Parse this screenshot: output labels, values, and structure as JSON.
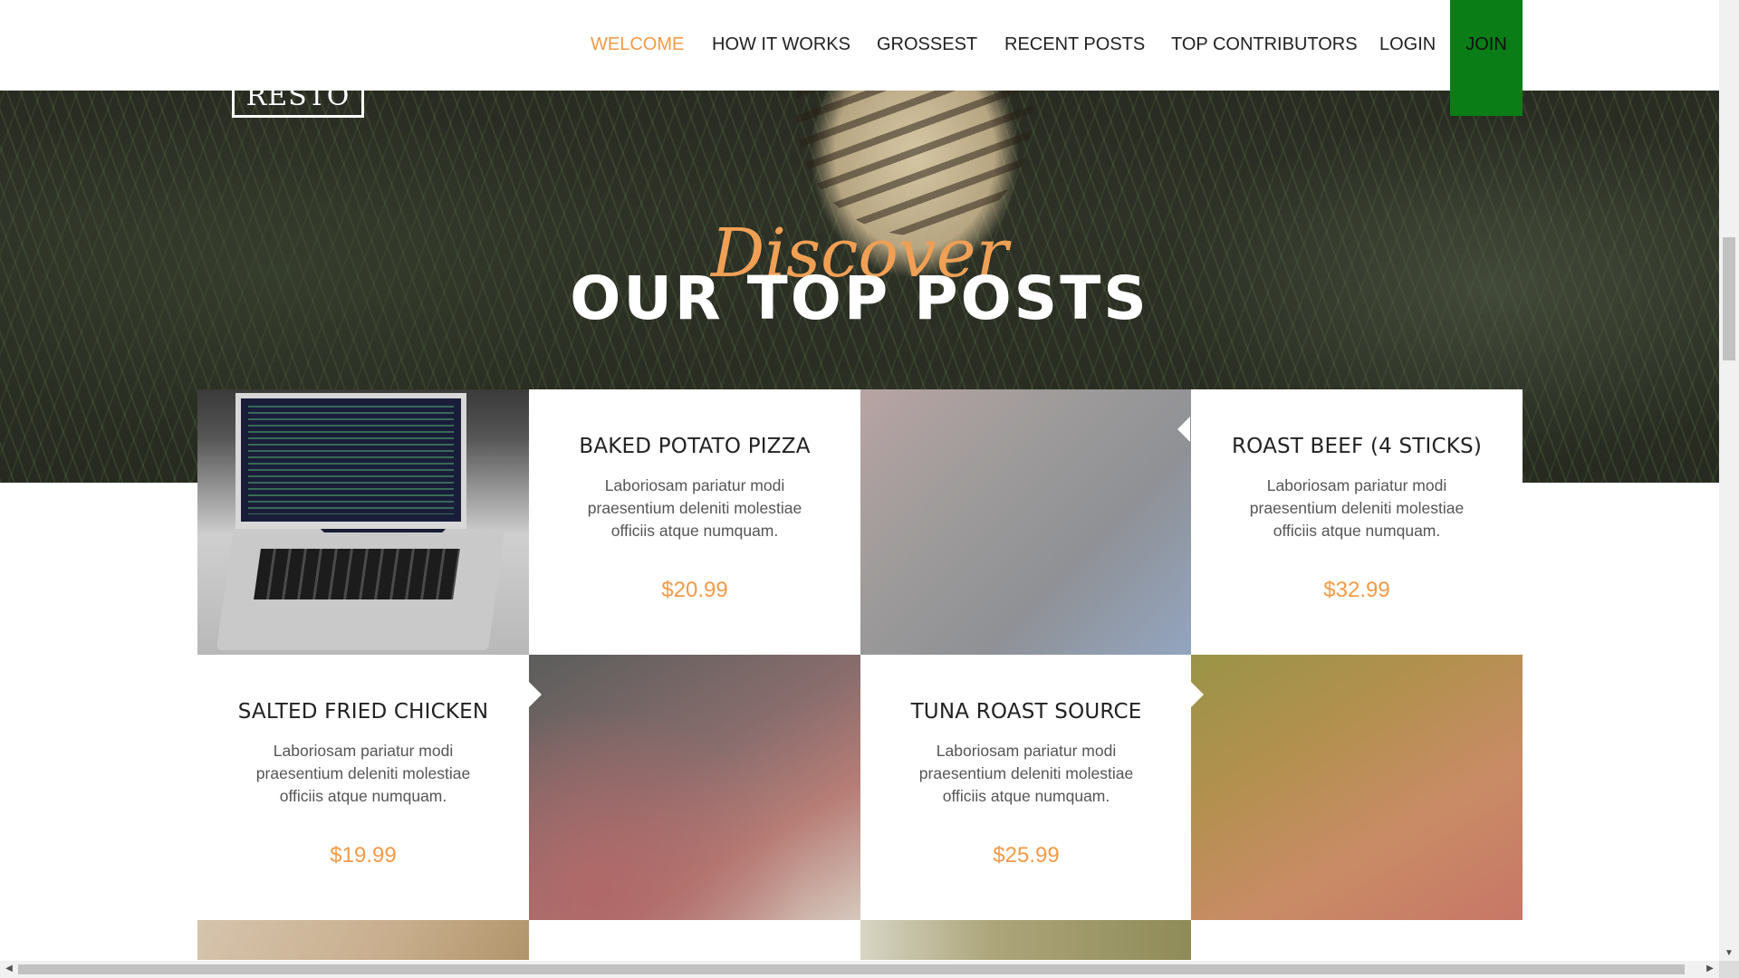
{
  "brand": {
    "text": "RESTO"
  },
  "nav": {
    "items": [
      {
        "label": "WELCOME",
        "active": true
      },
      {
        "label": "HOW IT WORKS"
      },
      {
        "label": "GROSSEST"
      },
      {
        "label": "RECENT POSTS"
      },
      {
        "label": "TOP CONTRIBUTORS"
      },
      {
        "label": "LOGIN"
      }
    ],
    "join_label": "JOIN"
  },
  "hero": {
    "script_text": "Discover",
    "title": "OUR TOP POSTS"
  },
  "posts": [
    {
      "name": "BAKED POTATO PIZZA",
      "description": "Laboriosam pariatur modi praesentium deleniti molestiae officiis atque numquam.",
      "price": "$20.99"
    },
    {
      "name": "ROAST BEEF (4 STICKS)",
      "description": "Laboriosam pariatur modi praesentium deleniti molestiae officiis atque numquam.",
      "price": "$32.99"
    },
    {
      "name": "SALTED FRIED CHICKEN",
      "description": "Laboriosam pariatur modi praesentium deleniti molestiae officiis atque numquam.",
      "price": "$19.99"
    },
    {
      "name": "TUNA ROAST SOURCE",
      "description": "Laboriosam pariatur modi praesentium deleniti molestiae officiis atque numquam.",
      "price": "$25.99"
    }
  ],
  "colors": {
    "accent": "#f39a47",
    "join_bg": "#0a7d16",
    "text_dark": "#222222",
    "text_muted": "#555555"
  },
  "icons": {
    "scroll_up": "triangle-up-icon",
    "scroll_down": "triangle-down-icon",
    "scroll_left": "triangle-left-icon",
    "scroll_right": "triangle-right-icon"
  }
}
